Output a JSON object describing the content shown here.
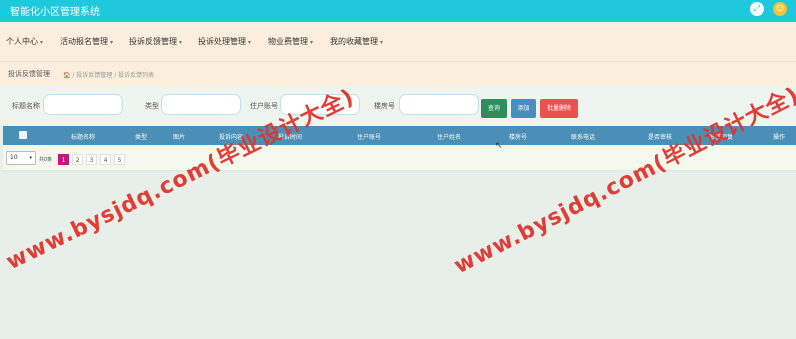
{
  "app": {
    "title": "智能化小区管理系统"
  },
  "nav": {
    "items": [
      {
        "label": "个人中心"
      },
      {
        "label": "活动报名管理"
      },
      {
        "label": "投诉反馈管理"
      },
      {
        "label": "投诉处理管理"
      },
      {
        "label": "物业费管理"
      },
      {
        "label": "我的收藏管理"
      }
    ]
  },
  "breadcrumb": {
    "title": "投诉反馈管理",
    "path": "🏠 / 投诉反馈管理 / 投诉反馈列表"
  },
  "filters": {
    "fields": [
      {
        "label": "标题名称",
        "value": ""
      },
      {
        "label": "类型",
        "value": ""
      },
      {
        "label": "住户账号",
        "value": ""
      },
      {
        "label": "楼房号",
        "value": ""
      }
    ],
    "search_label": "查询",
    "add_label": "添加",
    "delete_label": "批量删除"
  },
  "table": {
    "columns": [
      "标题名称",
      "类型",
      "图片",
      "投诉内容",
      "投诉时间",
      "住户账号",
      "住户姓名",
      "楼房号",
      "联系电话",
      "是否审核",
      "审核回复",
      "操作"
    ]
  },
  "pagination": {
    "page_size": "10",
    "total_label": "共0条",
    "pages": [
      "1",
      "2",
      "3",
      "4",
      "5"
    ],
    "current": "1"
  },
  "watermark": {
    "text": "www.bysjdq.com(毕业设计大全)"
  },
  "colors": {
    "topbar": "#1fc8dd",
    "navbar": "#fbeedd",
    "table_header": "#4a8fb6",
    "delete_button": "#ee4f4f",
    "search_button": "#2a8f5d",
    "add_button": "#4a8ec0",
    "active_page": "#c7177e",
    "watermark": "#e0342e"
  }
}
